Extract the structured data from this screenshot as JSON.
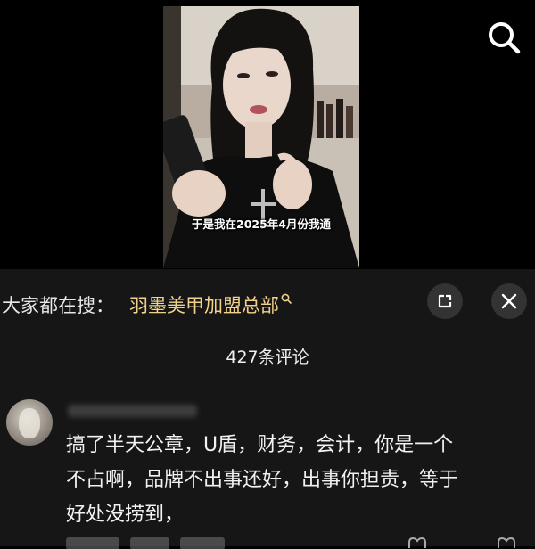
{
  "video": {
    "subtitle": "于是我在2025年4月份我通"
  },
  "header": {
    "search_icon": "search-icon"
  },
  "suggestion": {
    "prefix": "大家都在搜：",
    "query": "羽墨美甲加盟总部",
    "link_color": "#f1d28a",
    "icon": "mini-search-icon"
  },
  "controls": {
    "expand_icon": "expand-icon",
    "close_icon": "close-icon"
  },
  "comments": {
    "count_label": "427条评论",
    "items": [
      {
        "lines": [
          "搞了半天公章，U盾，财务，会计，你是一个",
          "不占啊，品牌不出事还好，出事你担责，等于",
          "好处没捞到，"
        ]
      }
    ]
  }
}
